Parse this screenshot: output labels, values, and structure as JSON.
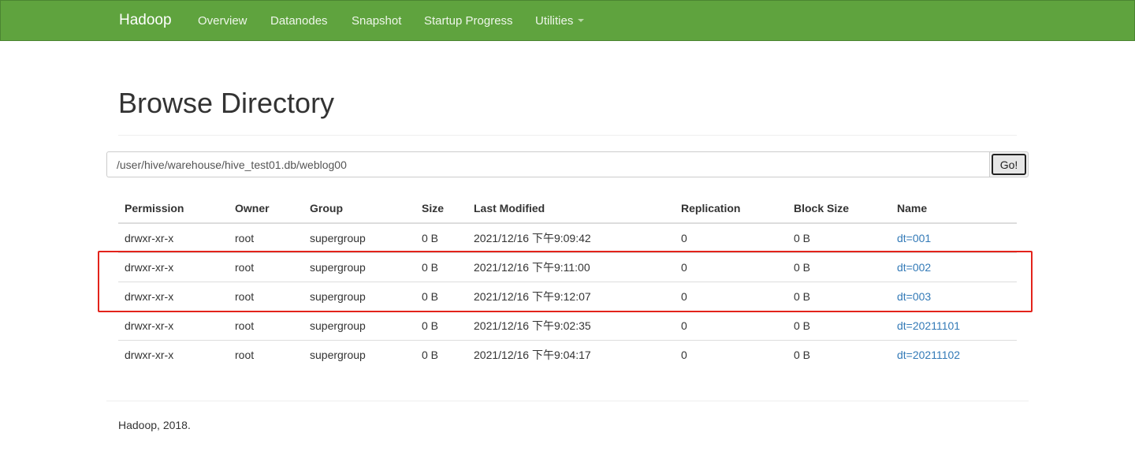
{
  "navbar": {
    "brand": "Hadoop",
    "items": [
      "Overview",
      "Datanodes",
      "Snapshot",
      "Startup Progress",
      "Utilities"
    ],
    "background_color": "#5fa33e"
  },
  "page": {
    "title": "Browse Directory"
  },
  "path_bar": {
    "value": "/user/hive/warehouse/hive_test01.db/weblog00",
    "go_label": "Go!"
  },
  "table": {
    "headers": [
      "Permission",
      "Owner",
      "Group",
      "Size",
      "Last Modified",
      "Replication",
      "Block Size",
      "Name"
    ],
    "rows": [
      {
        "permission": "drwxr-xr-x",
        "owner": "root",
        "group": "supergroup",
        "size": "0 B",
        "modified": "2021/12/16 下午9:09:42",
        "replication": "0",
        "block_size": "0 B",
        "name": "dt=001"
      },
      {
        "permission": "drwxr-xr-x",
        "owner": "root",
        "group": "supergroup",
        "size": "0 B",
        "modified": "2021/12/16 下午9:11:00",
        "replication": "0",
        "block_size": "0 B",
        "name": "dt=002"
      },
      {
        "permission": "drwxr-xr-x",
        "owner": "root",
        "group": "supergroup",
        "size": "0 B",
        "modified": "2021/12/16 下午9:12:07",
        "replication": "0",
        "block_size": "0 B",
        "name": "dt=003"
      },
      {
        "permission": "drwxr-xr-x",
        "owner": "root",
        "group": "supergroup",
        "size": "0 B",
        "modified": "2021/12/16 下午9:02:35",
        "replication": "0",
        "block_size": "0 B",
        "name": "dt=20211101"
      },
      {
        "permission": "drwxr-xr-x",
        "owner": "root",
        "group": "supergroup",
        "size": "0 B",
        "modified": "2021/12/16 下午9:04:17",
        "replication": "0",
        "block_size": "0 B",
        "name": "dt=20211102"
      }
    ],
    "link_color": "#337ab7",
    "highlight_color": "#e3231b"
  },
  "footer": {
    "text": "Hadoop, 2018."
  }
}
